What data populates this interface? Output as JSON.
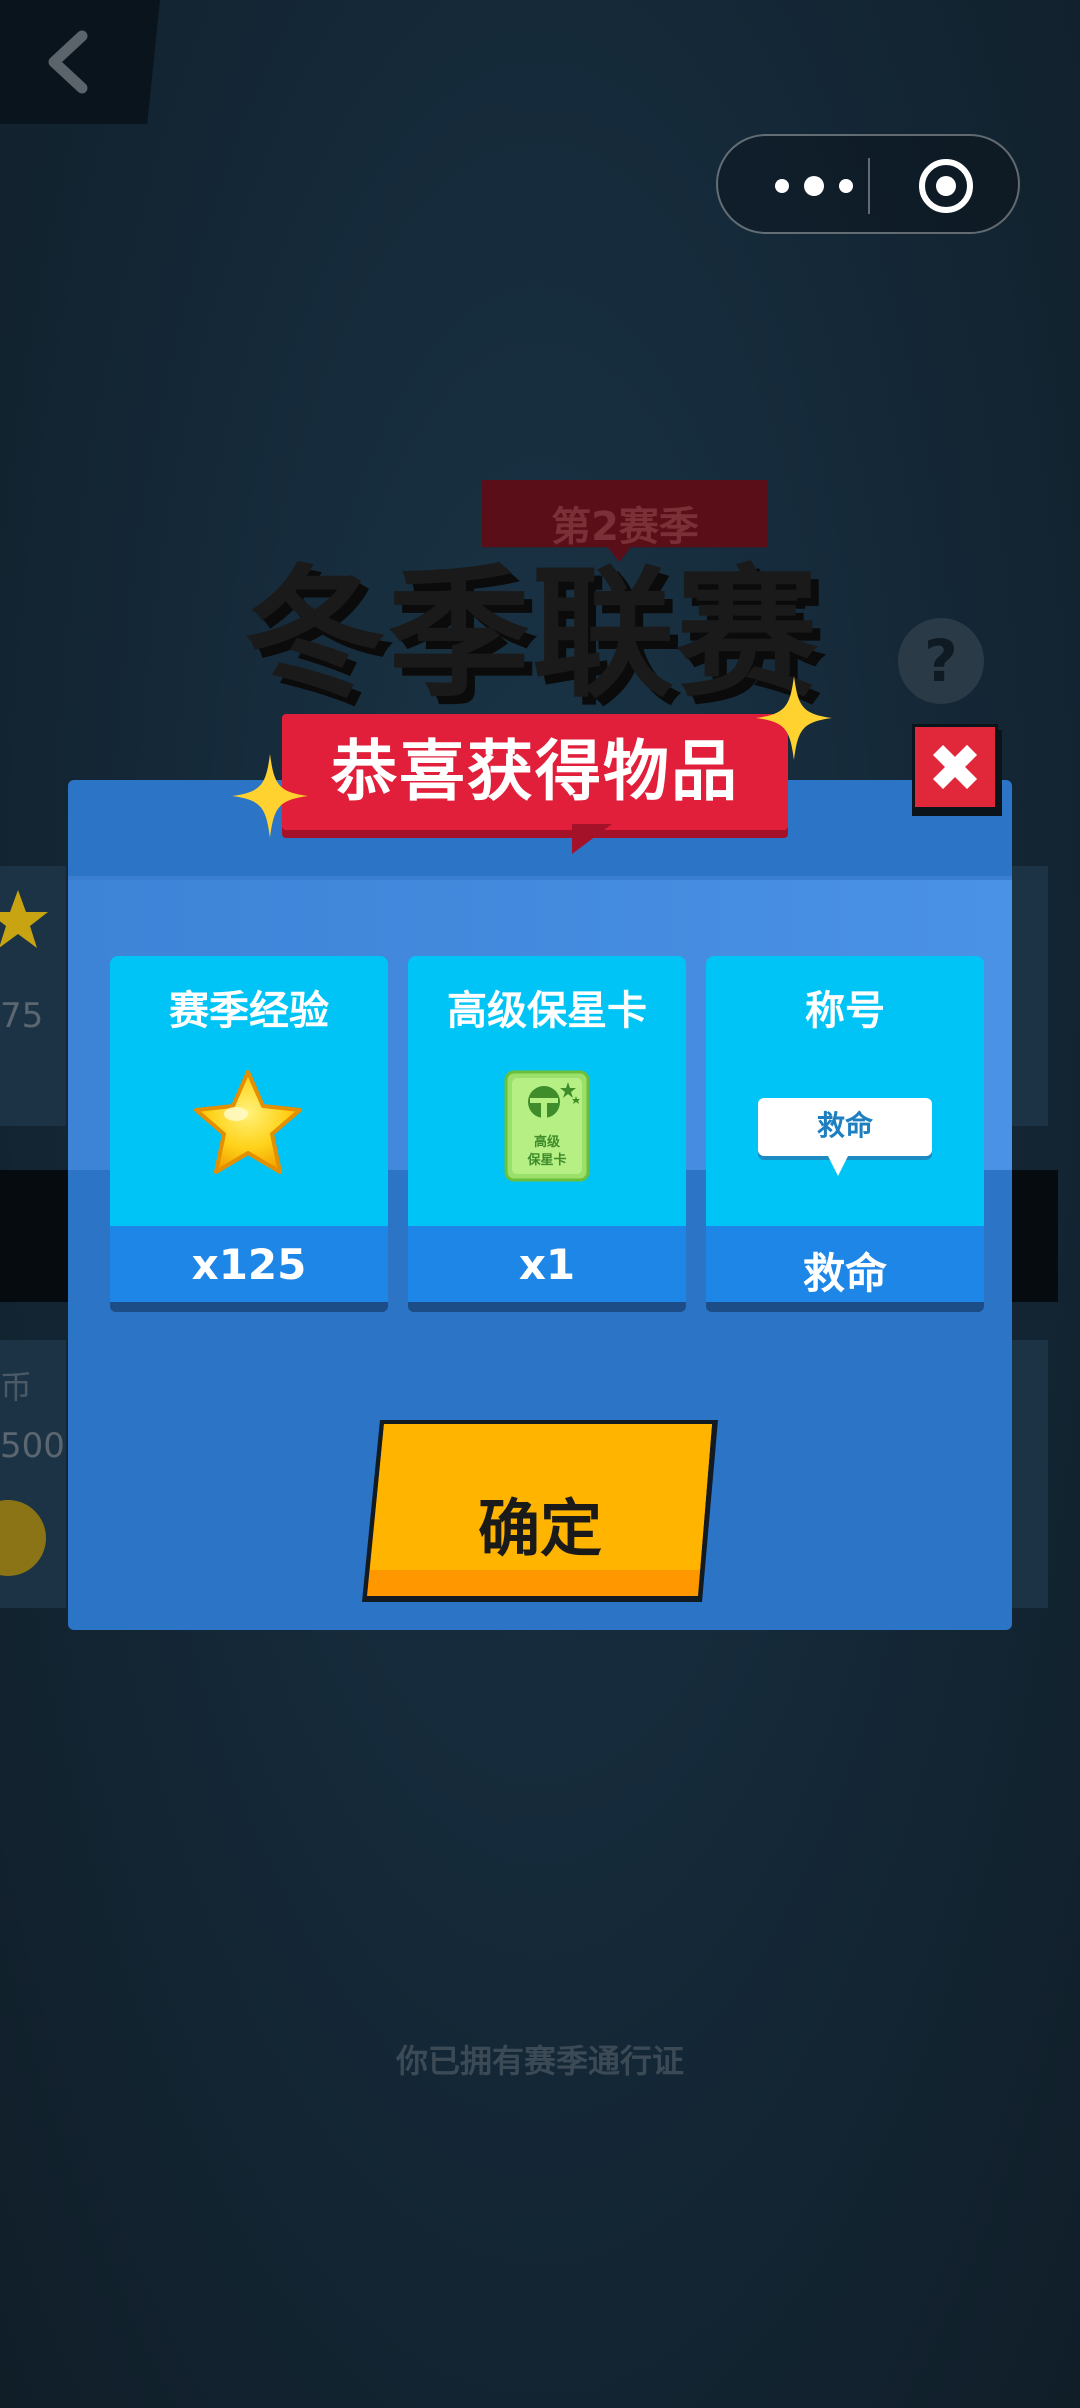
{
  "header": {
    "back_icon": "chevron-left-icon",
    "capsule_more_icon": "more-dots-icon",
    "capsule_close_icon": "target-close-icon"
  },
  "background": {
    "season_label": "第2赛季",
    "title": "冬季联赛",
    "help_label": "?",
    "left_partial_value_1": "75",
    "left_partial_value_2": "500",
    "left_partial_label": "币",
    "pass_status": "你已拥有赛季通行证"
  },
  "modal": {
    "title": "恭喜获得物品",
    "close_label": "✖",
    "items": [
      {
        "title": "赛季经验",
        "value": "x125",
        "icon": "star-icon"
      },
      {
        "title": "高级保星卡",
        "value": "x1",
        "icon": "star-protect-card-icon",
        "icon_text": "高级\n保星卡"
      },
      {
        "title": "称号",
        "value": "救命",
        "icon": "speech-bubble-icon",
        "icon_text": "救命"
      }
    ],
    "confirm_label": "确定"
  },
  "colors": {
    "modal_bg": "#2c74c6",
    "ribbon": "#e21f3b",
    "card_top": "#00c4f5",
    "card_bottom": "#1e86e6",
    "confirm": "#ffb400",
    "close": "#e0283a"
  }
}
